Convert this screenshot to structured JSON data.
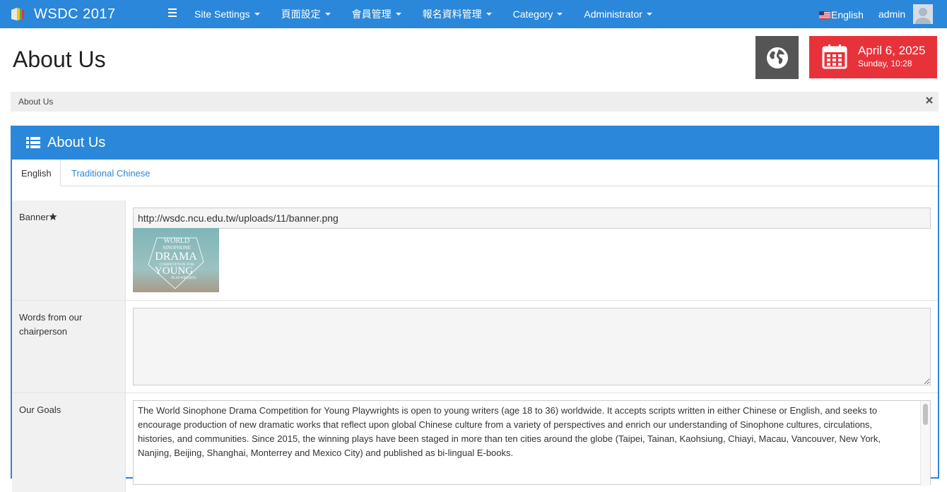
{
  "navbar": {
    "brand_title": "WSDC 2017",
    "menu": [
      "Site Settings",
      "頁面設定",
      "會員管理",
      "報名資料管理",
      "Category",
      "Administrator"
    ],
    "language": "English",
    "username": "admin"
  },
  "page": {
    "title": "About Us",
    "date_main": "April 6, 2025",
    "date_sub": "Sunday, 10:28"
  },
  "breadcrumb": {
    "current": "About Us"
  },
  "panel": {
    "title": "About Us",
    "tabs": [
      "English",
      "Traditional Chinese"
    ]
  },
  "form": {
    "banner_label": "Banner",
    "banner_value": "http://wsdc.ncu.edu.tw/uploads/11/banner.png",
    "chair_label": "Words from our chairperson",
    "chair_value": "",
    "goals_label": "Our Goals",
    "goals_value": "The World Sinophone Drama Competition for Young Playwrights is open to young writers (age 18 to 36) worldwide. It accepts scripts written in either Chinese or English, and seeks to encourage production of new dramatic works that reflect upon global Chinese culture from a variety of perspectives and enrich our understanding of Sinophone cultures, circulations, histories, and communities. Since 2015, the winning plays have been staged in more than ten cities around the globe (Taipei, Tainan, Kaohsiung, Chiayi, Macau, Vancouver, New York, Nanjing, Beijing, Shanghai, Monterrey and Mexico City) and published as bi-lingual E-books."
  },
  "banner_image": {
    "line1": "WORLD",
    "line2": "SINOPHONE",
    "line3": "DRAMA",
    "line4": "COMPETITION FOR",
    "line5": "YOUNG",
    "line6": "PLAYWRIGHTS"
  },
  "colors": {
    "primary": "#2b87d9",
    "date_tile": "#e8323a",
    "globe_tile": "#555555",
    "breadcrumb_bg": "#eeeeee"
  },
  "icons": [
    "logo-icon",
    "menu-toggle-icon",
    "caret-down-icon",
    "us-flag-icon",
    "avatar-icon",
    "globe-icon",
    "calendar-icon",
    "close-icon",
    "list-icon",
    "star-icon"
  ]
}
